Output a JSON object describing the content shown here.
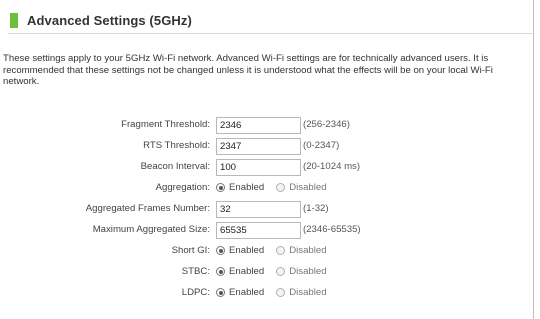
{
  "header": {
    "title": "Advanced Settings (5GHz)",
    "accent_color": "#6cbf3c"
  },
  "description": "These settings apply to your 5GHz Wi-Fi network. Advanced Wi-Fi settings are for technically advanced users. It is recommended that these settings not be changed unless it is understood what the effects will be on your local Wi-Fi network.",
  "fields": [
    {
      "label": "Fragment Threshold:",
      "value": "2346",
      "hint": "(256-2346)"
    },
    {
      "label": "RTS Threshold:",
      "value": "2347",
      "hint": "(0-2347)"
    },
    {
      "label": "Beacon Interval:",
      "value": "100",
      "hint": "(20-1024 ms)"
    },
    {
      "label": "Aggregation:",
      "options": [
        "Enabled",
        "Disabled"
      ],
      "selected": "Enabled"
    },
    {
      "label": "Aggregated Frames Number:",
      "value": "32",
      "hint": "(1-32)"
    },
    {
      "label": "Maximum Aggregated Size:",
      "value": "65535",
      "hint": "(2346-65535)"
    },
    {
      "label": "Short GI:",
      "options": [
        "Enabled",
        "Disabled"
      ],
      "selected": "Enabled"
    },
    {
      "label": "STBC:",
      "options": [
        "Enabled",
        "Disabled"
      ],
      "selected": "Enabled"
    },
    {
      "label": "LDPC:",
      "options": [
        "Enabled",
        "Disabled"
      ],
      "selected": "Enabled"
    }
  ]
}
